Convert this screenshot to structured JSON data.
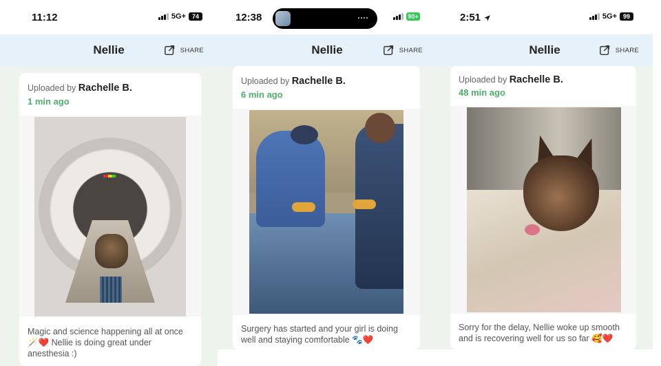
{
  "screens": [
    {
      "time": "11:12",
      "network": "5G+",
      "battery": "74",
      "header_title": "Nellie",
      "share_label": "SHARE",
      "uploaded_by_prefix": "Uploaded by",
      "uploader": "Rachelle B.",
      "time_ago": "1 min ago",
      "caption": "Magic and science happening all at once 🪄❤️ Nellie is doing great under anesthesia :)"
    },
    {
      "time": "12:38",
      "network": "",
      "battery": "90+",
      "header_title": "Nellie",
      "share_label": "SHARE",
      "uploaded_by_prefix": "Uploaded by",
      "uploader": "Rachelle B.",
      "time_ago": "6 min ago",
      "caption": "Surgery has started and your girl is doing well and staying comfortable 🐾❤️"
    },
    {
      "time": "2:51",
      "network": "5G+",
      "battery": "99",
      "header_title": "Nellie",
      "share_label": "SHARE",
      "uploaded_by_prefix": "Uploaded by",
      "uploader": "Rachelle B.",
      "time_ago": "48 min ago",
      "caption": "Sorry for the delay, Nellie woke up smooth and is recovering well for us so far 🥰❤️"
    }
  ],
  "colors": {
    "header_bg": "#e7f1f9",
    "feed_bg": "#eef3ee",
    "time_ago_green": "#4caf6a",
    "battery_green": "#34c759"
  },
  "icons": [
    "share-icon",
    "location-arrow-icon",
    "signal-icon"
  ]
}
